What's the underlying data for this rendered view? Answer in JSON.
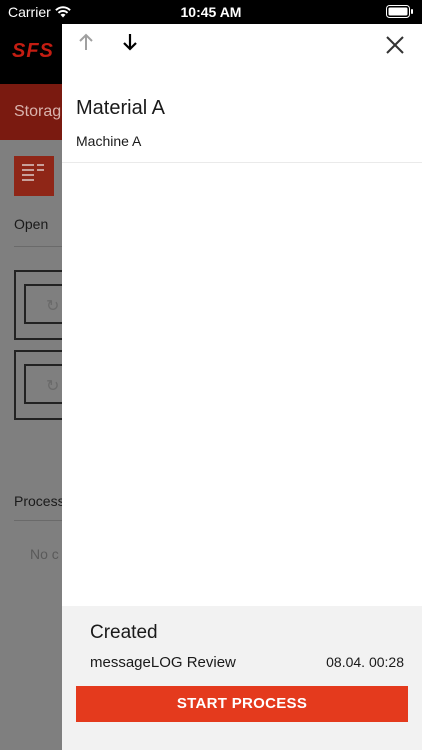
{
  "status_bar": {
    "carrier": "Carrier",
    "time": "10:45 AM"
  },
  "background": {
    "logo": "SFS",
    "section_label": "Storag",
    "open_label": "Open",
    "process_label": "Process",
    "empty_label": "No c",
    "accent_color": "#e43a1d"
  },
  "panel": {
    "material": "Material A",
    "machine": "Machine A",
    "created_title": "Created",
    "created_review": "messageLOG Review",
    "created_time": "08.04. 00:28",
    "start_label": "START PROCESS"
  },
  "icons": {
    "nav_up": "arrow-up-icon",
    "nav_down": "arrow-down-icon",
    "close": "close-icon"
  }
}
